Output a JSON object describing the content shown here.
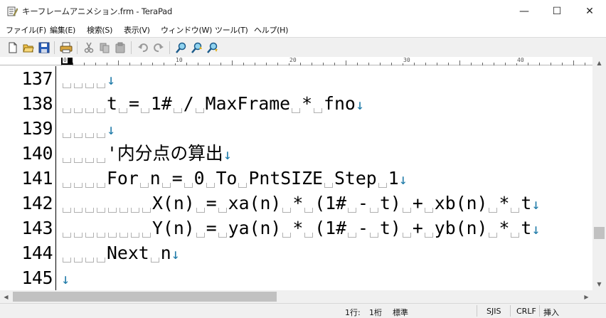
{
  "window": {
    "title": "キーフレームアニメション.frm - TeraPad",
    "minimize_glyph": "—",
    "maximize_glyph": "☐",
    "close_glyph": "✕"
  },
  "menu": [
    "ファイル(F)",
    "編集(E)",
    "検索(S)",
    "表示(V)",
    "ウィンドウ(W)",
    "ツール(T)",
    "ヘルプ(H)"
  ],
  "toolbar": {
    "buttons": [
      "new-file-icon",
      "open-folder-icon",
      "save-icon",
      "print-icon",
      "cut-icon",
      "copy-icon",
      "paste-icon",
      "undo-icon",
      "redo-icon",
      "find-icon",
      "find-prev-icon",
      "find-next-icon"
    ]
  },
  "ruler": {
    "labels": [
      "0",
      "10",
      "20",
      "30",
      "40"
    ]
  },
  "editor": {
    "lines": [
      {
        "num": "137",
        "indent": 4,
        "code": ""
      },
      {
        "num": "138",
        "indent": 4,
        "code": "t = 1# / MaxFrame * fno"
      },
      {
        "num": "139",
        "indent": 4,
        "code": ""
      },
      {
        "num": "140",
        "indent": 4,
        "code": "'内分点の算出"
      },
      {
        "num": "141",
        "indent": 4,
        "code": "For n = 0 To PntSIZE Step 1"
      },
      {
        "num": "142",
        "indent": 8,
        "code": "X(n) = xa(n) * (1# - t) + xb(n) * t"
      },
      {
        "num": "143",
        "indent": 8,
        "code": "Y(n) = ya(n) * (1# - t) + yb(n) * t"
      },
      {
        "num": "144",
        "indent": 4,
        "code": "Next n"
      },
      {
        "num": "145",
        "indent": 0,
        "code": ""
      }
    ],
    "newline_glyph": "↓"
  },
  "scrollbar": {
    "vertical_position": 0.8,
    "horizontal_position": 0.0,
    "up_glyph": "▲",
    "down_glyph": "▼",
    "left_glyph": "◀",
    "right_glyph": "▶"
  },
  "status": {
    "row": "1行:",
    "col": "1桁",
    "mode": "標準",
    "encoding": "SJIS",
    "line_ending": "CRLF",
    "insert": "挿入"
  },
  "colors": {
    "newline_mark": "#1e7aa8",
    "text": "#000000",
    "toolbar_bg": "#f0f0f0"
  }
}
